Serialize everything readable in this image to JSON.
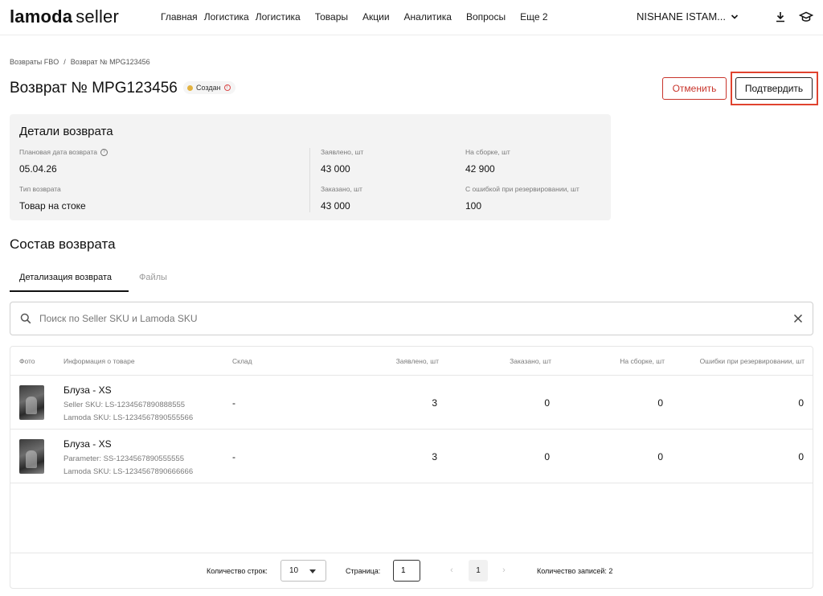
{
  "header": {
    "logo_brand": "lamoda",
    "logo_sub": "seller",
    "nav": [
      "Главная",
      "Логистика",
      "Логистика",
      "Товары",
      "Акции",
      "Аналитика",
      "Вопросы",
      "Еще 2"
    ],
    "account": "NISHANE ISTAM...",
    "icons": [
      "download-icon",
      "graduation-cap-icon"
    ]
  },
  "breadcrumb": {
    "parent": "Возвраты FBO",
    "separator": "/",
    "current": "Возврат № MPG123456"
  },
  "page": {
    "title": "Возврат № MPG123456",
    "status": "Создан",
    "status_color": "#e3b341",
    "cancel_label": "Отменить",
    "confirm_label": "Подтвердить",
    "cancel_color": "#c8342b",
    "highlight_color": "#e0432f"
  },
  "details": {
    "title": "Детали возврата",
    "planned_date_label": "Плановая дата возврата",
    "planned_date": "05.04.26",
    "return_type_label": "Тип возврата",
    "return_type": "Товар на стоке",
    "declared_label": "Заявлено, шт",
    "declared": "43 000",
    "ordered_label": "Заказано, шт",
    "ordered": "43 000",
    "assembly_label": "На сборке, шт",
    "assembly": "42 900",
    "reserve_errors_label": "С ошибкой при резервировании, шт",
    "reserve_errors": "100"
  },
  "composition": {
    "title": "Состав возврата",
    "tabs": [
      "Детализация возврата",
      "Файлы"
    ],
    "active_tab": 0
  },
  "search": {
    "placeholder": "Поиск по Seller SKU и Lamoda SKU",
    "value": ""
  },
  "table": {
    "columns": [
      "Фото",
      "Информация о товаре",
      "Склад",
      "Заявлено, шт",
      "Заказано, шт",
      "На сборке, шт",
      "Ошибки при резервировании, шт"
    ],
    "rows": [
      {
        "name": "Блуза - XS",
        "meta1": "Seller SKU: LS-1234567890888555",
        "meta2": "Lamoda SKU: LS-1234567890555566",
        "warehouse": "-",
        "declared": "3",
        "ordered": "0",
        "assembly": "0",
        "errors": "0"
      },
      {
        "name": "Блуза - XS",
        "meta1": "Parameter: SS-1234567890555555",
        "meta2": "Lamoda SKU: LS-1234567890666666",
        "warehouse": "-",
        "declared": "3",
        "ordered": "0",
        "assembly": "0",
        "errors": "0"
      }
    ]
  },
  "pagination": {
    "rows_label": "Количество строк:",
    "rows_value": "10",
    "page_label": "Страница:",
    "page_value": "1",
    "current_page": "1",
    "records_label": "Количество записей: 2"
  }
}
